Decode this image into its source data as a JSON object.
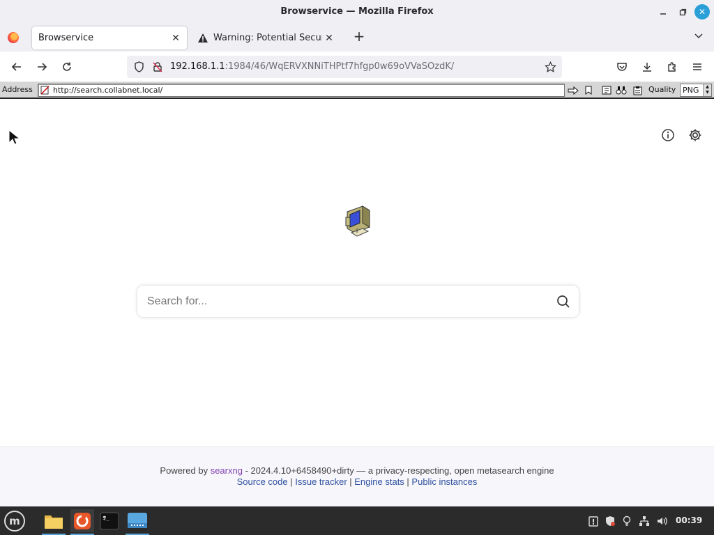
{
  "window": {
    "title": "Browservice — Mozilla Firefox",
    "minimize_icon": "minimize-icon",
    "maximize_icon": "maximize-icon",
    "close_icon": "close-icon"
  },
  "tabs": [
    {
      "label": "Browservice",
      "active": true
    },
    {
      "label": "Warning: Potential Security Risk Ahead",
      "active": false,
      "icon": "warning-icon"
    }
  ],
  "navbar": {
    "url_host": "192.168.1.1",
    "url_rest": ":1984/46/WqERVXNNiTHPtf7hfgp0w69oVVaSOzdK/"
  },
  "browservice": {
    "address_label": "Address",
    "address_value": "http://search.collabnet.local/",
    "quality_label": "Quality",
    "quality_value": "PNG"
  },
  "search": {
    "placeholder": "Search for..."
  },
  "footer": {
    "powered_by": "Powered by",
    "brand": "searxng",
    "version_text": " - 2024.4.10+6458490+dirty — a privacy-respecting, open metasearch engine",
    "links": [
      "Source code",
      "Issue tracker",
      "Engine stats",
      "Public instances"
    ],
    "separator": " | "
  },
  "taskbar": {
    "clock": "00:39"
  },
  "colors": {
    "accent": "#2a9fd8",
    "brand_link": "#8040b0",
    "footer_link": "#3050a0"
  }
}
